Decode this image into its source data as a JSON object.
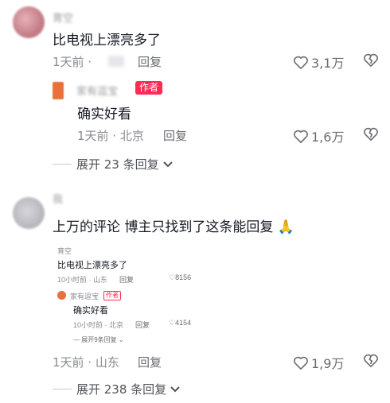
{
  "comment1": {
    "username": "育空",
    "text": "比电视上漂亮多了",
    "meta": "1天前 ·",
    "reply_label": "回复",
    "likes": "3,1万"
  },
  "reply1": {
    "username": "家有逗宝",
    "author_badge": "作者",
    "text": "确实好看",
    "meta": "1天前 · 北京",
    "reply_label": "回复",
    "likes": "1,6万"
  },
  "expand1": {
    "label": "展开 23 条回复"
  },
  "comment2": {
    "username": "我",
    "text": "上万的评论 博主只找到了这条能回复",
    "emoji": "🙏",
    "meta": "1天前 · 山东",
    "reply_label": "回复",
    "likes": "1,9万"
  },
  "expand2": {
    "label": "展开 238 条回复"
  },
  "screenshot": {
    "username": "育空",
    "text": "比电视上漂亮多了",
    "meta": "10小时前 · 山东",
    "reply_label": "回复",
    "likes": "8156",
    "reply": {
      "username": "家有逗宝",
      "author_badge": "作者",
      "text": "确实好看",
      "meta": "10小时前 · 北京",
      "reply_label": "回复",
      "likes": "4154"
    },
    "expand_label": "展开9条回复"
  },
  "colors": {
    "accent": "#fe2c55",
    "muted": "#8a8b91",
    "emoji": "#f5b800"
  }
}
